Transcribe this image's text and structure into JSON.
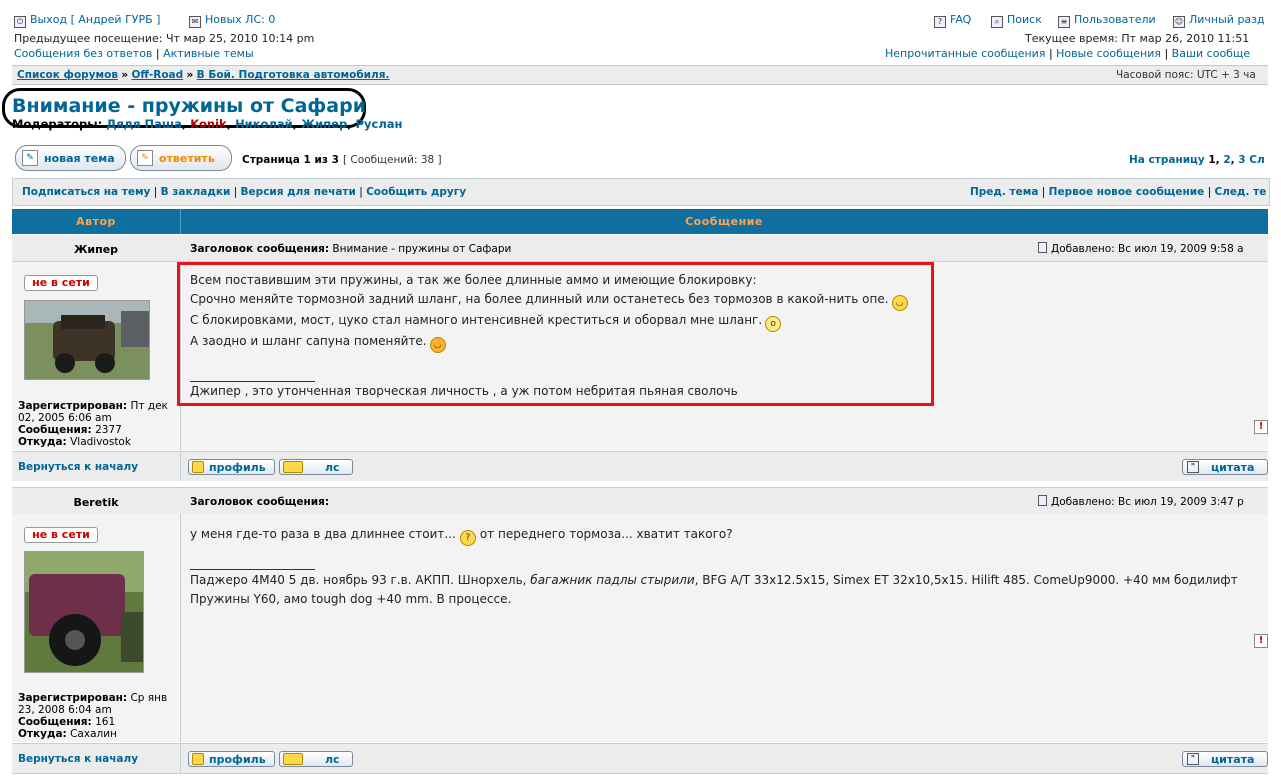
{
  "header": {
    "logout": "Выход [ Андрей ГУРБ ]",
    "new_pm": "Новых ЛС: 0",
    "last_visit": "Предыдущее посещение: Чт мар 25, 2010 10:14 pm",
    "unanswered": "Сообщения без ответов",
    "active": "Активные темы",
    "faq": "FAQ",
    "search": "Поиск",
    "users": "Пользователи",
    "personal": "Личный разд",
    "current_time": "Текущее время: Пт мар 26, 2010 11:51",
    "unread": "Непрочитанные сообщения",
    "new_posts": "Новые сообщения",
    "your_posts": "Ваши сообще"
  },
  "breadcrumb": {
    "forum_list": "Список форумов",
    "offroad": "Off-Road",
    "section": "В Бой. Подготовка автомобиля.",
    "sep": "»",
    "timezone": "Часовой пояс: UTC + 3 ча"
  },
  "topic": {
    "title": "Внимание - пружины от Сафари",
    "moderators_label": "Модераторы:",
    "moderators": [
      "Дядя Паша",
      "Konik",
      "Николай",
      "Жипер",
      "Руслан"
    ]
  },
  "toolbar": {
    "new_topic": "новая тема",
    "reply": "ответить",
    "page_info": "Страница 1 из 3",
    "post_count": "[ Сообщений: 38 ]",
    "goto_page": "На страницу",
    "pages": [
      "1",
      "2",
      "3"
    ],
    "pages_next": "Сл"
  },
  "actions": {
    "subscribe": "Подписаться на тему",
    "bookmark": "В закладки",
    "print": "Версия для печати",
    "email": "Сообщить другу",
    "prev": "Пред. тема",
    "first_new": "Первое новое сообщение",
    "next": "След. те"
  },
  "table_head": {
    "author": "Автор",
    "message": "Сообщение"
  },
  "posts": [
    {
      "author": "Жипер",
      "subject_label": "Заголовок сообщения:",
      "subject": "Внимание - пружины от Сафари",
      "posted": "Добавлено: Вс июл 19, 2009 9:58 a",
      "status": "не в сети",
      "lines": [
        "Всем поставившим эти пружины, а так же более длинные аммо и имеющие блокировку:",
        "Срочно меняйте тормозной задний шланг, на более длинный или останетесь без тормозов в какой-нить опе.",
        "С блокировками, мост, цуко стал намного интенсивней креститься и оборвал мне шланг.",
        "А заодно и шланг сапуна поменяйте."
      ],
      "signature": "Джипер , это утонченная творческая личность , а уж потом небритая пьяная сволочь",
      "reg_label": "Зарегистрирован:",
      "reg": "Пт дек 02, 2005 6:06 am",
      "msgs_label": "Сообщения:",
      "msgs": "2377",
      "from_label": "Откуда:",
      "from": "Vladivostok"
    },
    {
      "author": "Beretik",
      "subject_label": "Заголовок сообщения:",
      "subject": "",
      "posted": "Добавлено: Вс июл 19, 2009 3:47 p",
      "status": "не в сети",
      "line1a": "у меня где-то раза в два длиннее стоит...",
      "line1b": "от переднего тормоза... хватит такого?",
      "sig1a": "Паджеро 4М40 5 дв. ноябрь 93 г.в. АКПП. Шнорхель,",
      "sig1b": "багажник падлы стырили",
      "sig1c": ", BFG A/T 33x12.5x15, Simex ET 32x10,5x15. Hilift 485. ComeUp9000. +40 мм бодилифт",
      "sig2": "Пружины Y60, амо tough dog +40 mm. В процессе.",
      "reg_label": "Зарегистрирован:",
      "reg": "Ср янв 23, 2008 6:04 am",
      "msgs_label": "Сообщения:",
      "msgs": "161",
      "from_label": "Откуда:",
      "from": "Сахалин"
    }
  ],
  "post_buttons": {
    "back_top": "Вернуться к началу",
    "profile": "профиль",
    "pm": "лс",
    "quote": "цитата"
  }
}
